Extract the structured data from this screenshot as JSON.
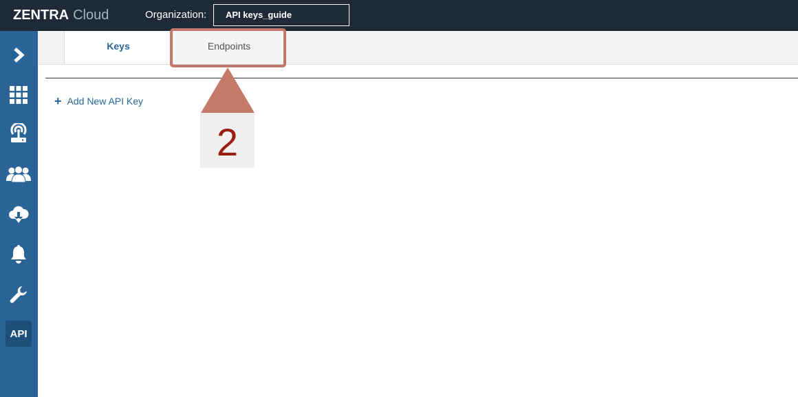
{
  "app": {
    "brand_bold": "ZENTRA",
    "brand_light": "Cloud"
  },
  "header": {
    "org_label": "Organization:",
    "org_value": "API keys_guide"
  },
  "sidebar": {
    "items": [
      {
        "icon": "chevron-right-icon"
      },
      {
        "icon": "grid-icon"
      },
      {
        "icon": "access-point-icon"
      },
      {
        "icon": "users-icon"
      },
      {
        "icon": "cloud-download-icon"
      },
      {
        "icon": "bell-icon"
      },
      {
        "icon": "wrench-icon"
      },
      {
        "icon": "api-icon",
        "label": "API",
        "active": true
      }
    ]
  },
  "tabs": [
    {
      "label": "Keys",
      "active": true
    },
    {
      "label": "Endpoints",
      "active": false
    }
  ],
  "content": {
    "add_key_label": "Add New API Key"
  },
  "annotation": {
    "step_number": "2",
    "color": "#c07868",
    "number_color": "#9b1c10"
  },
  "colors": {
    "topbar": "#1f2a38",
    "sidebar": "#2a6496",
    "accent": "#2a6496"
  }
}
